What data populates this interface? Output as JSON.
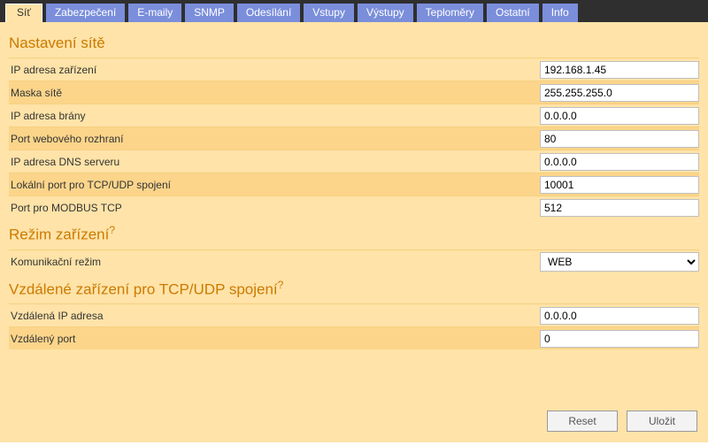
{
  "tabs": [
    {
      "label": "Síť",
      "active": true
    },
    {
      "label": "Zabezpečení"
    },
    {
      "label": "E-maily"
    },
    {
      "label": "SNMP"
    },
    {
      "label": "Odesílání"
    },
    {
      "label": "Vstupy"
    },
    {
      "label": "Výstupy"
    },
    {
      "label": "Teploměry"
    },
    {
      "label": "Ostatní"
    },
    {
      "label": "Info"
    }
  ],
  "sections": {
    "net": {
      "title": "Nastavení sítě",
      "fields": {
        "ip": {
          "label": "IP adresa zařízení",
          "value": "192.168.1.45"
        },
        "mask": {
          "label": "Maska sítě",
          "value": "255.255.255.0"
        },
        "gateway": {
          "label": "IP adresa brány",
          "value": "0.0.0.0"
        },
        "webport": {
          "label": "Port webového rozhraní",
          "value": "80"
        },
        "dns": {
          "label": "IP adresa DNS serveru",
          "value": "0.0.0.0"
        },
        "localport": {
          "label": "Lokální port pro TCP/UDP spojení",
          "value": "10001"
        },
        "modbus": {
          "label": "Port pro MODBUS TCP",
          "value": "512"
        }
      }
    },
    "mode": {
      "title": "Režim zařízení",
      "help": "?",
      "fields": {
        "commmode": {
          "label": "Komunikační režim",
          "value": "WEB"
        }
      }
    },
    "remote": {
      "title": "Vzdálené zařízení pro TCP/UDP spojení",
      "help": "?",
      "fields": {
        "rip": {
          "label": "Vzdálená IP adresa",
          "value": "0.0.0.0"
        },
        "rport": {
          "label": "Vzdálený port",
          "value": "0"
        }
      }
    }
  },
  "buttons": {
    "reset": "Reset",
    "save": "Uložit"
  }
}
